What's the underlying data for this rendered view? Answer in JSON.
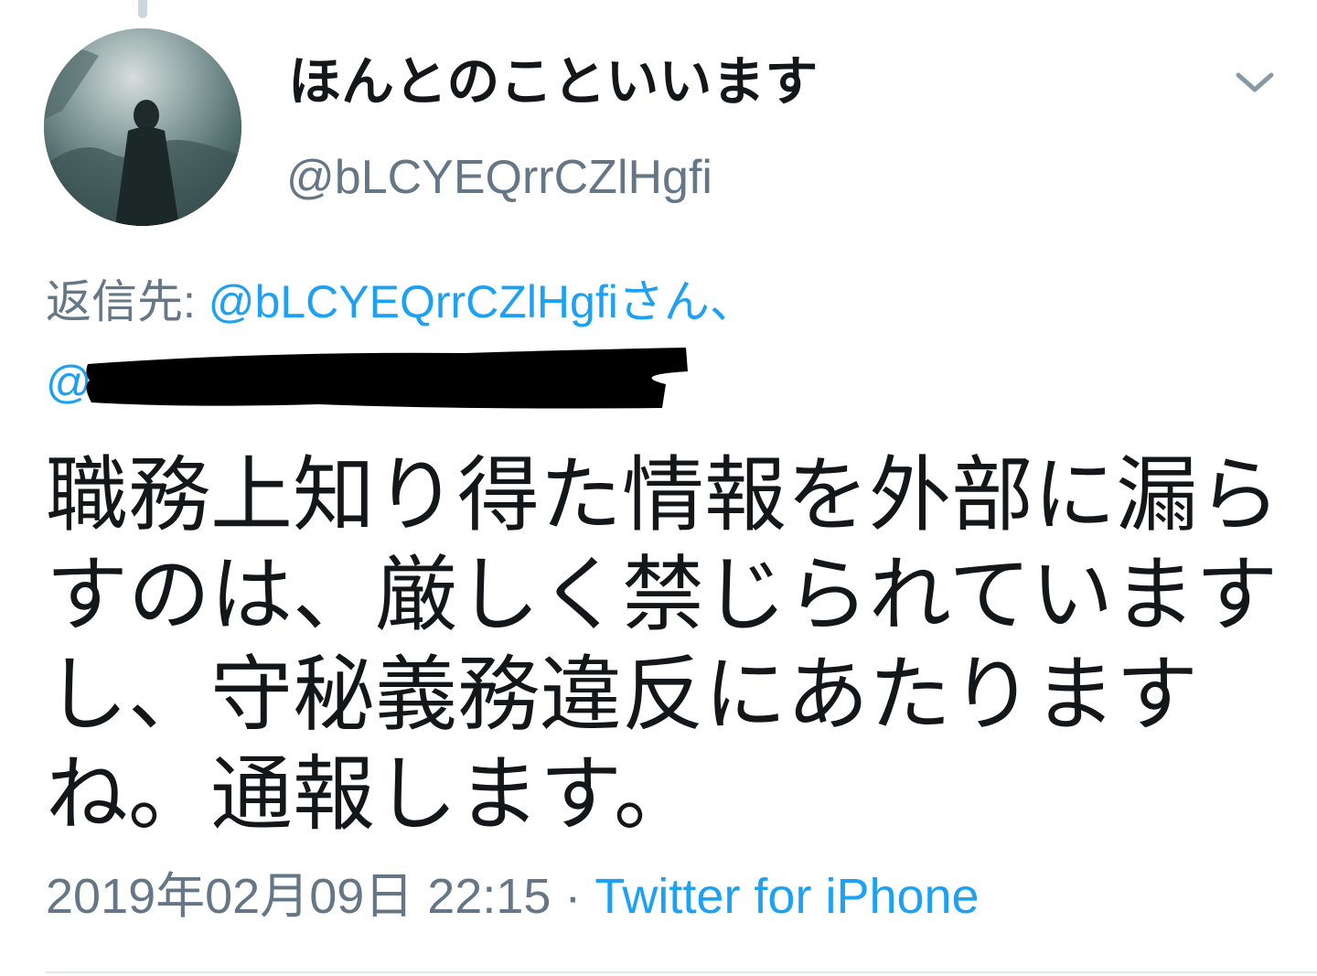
{
  "colors": {
    "text_primary": "#14171a",
    "text_secondary": "#657786",
    "link": "#1da1f2",
    "divider": "#e1e8ed"
  },
  "author": {
    "display_name": "ほんとのこといいます",
    "handle": "@bLCYEQrrCZlHgfi",
    "avatar_icon": "silhouette-avatar"
  },
  "reply": {
    "prefix": "返信先: ",
    "mention_1": "@bLCYEQrrCZlHgfiさん、",
    "mention_2_visible": "@"
  },
  "tweet": {
    "lines": [
      "職務上知り得た情報を外部に漏ら",
      "すのは、厳しく禁じられています",
      "し、守秘義務違反にあたります",
      "ね。通報します。"
    ]
  },
  "meta": {
    "timestamp": "2019年02月09日 22:15",
    "separator": " · ",
    "source": "Twitter for iPhone"
  },
  "menu": {
    "icon": "chevron-down-icon"
  }
}
